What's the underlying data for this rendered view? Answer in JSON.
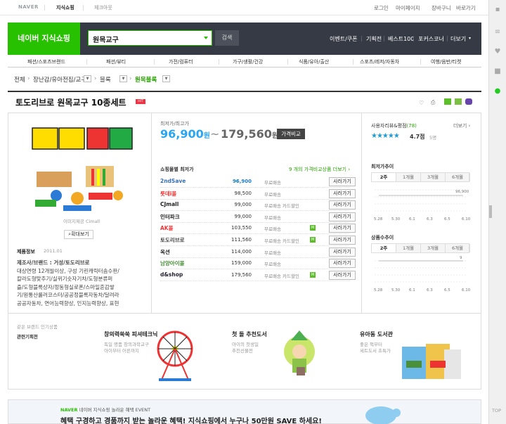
{
  "topbar": {
    "brand": "NAVER",
    "tab1": "지식쇼핑",
    "tab2": "체크아웃",
    "links": [
      "로그인",
      "마이페이지",
      "장바구니",
      "바로가기"
    ]
  },
  "header": {
    "logo": "네이버 지식쇼핑",
    "search_value": "원목교구",
    "search_btn": "검색",
    "links": [
      "이벤트/쿠폰",
      "기획전",
      "베스트100",
      "포커스코너",
      "더보기"
    ]
  },
  "categories": [
    "패션/스포츠브랜드",
    "패션/뷰티",
    "가전/컴퓨터",
    "가구/생활/건강",
    "식품/유아/출산",
    "스포츠/레저/자동차",
    "여행/음반/티켓"
  ],
  "breadcrumb": {
    "all": "전체",
    "c1": "장난감/유아전집/교구",
    "c2": "블록",
    "c3": "원목블록"
  },
  "product": {
    "title": "토도리브로 원목교구 10종세트",
    "hit": "HIT",
    "image_caption": "이미지제공 Cimall",
    "zoom_btn": "확대보기",
    "info_title": "제품정보",
    "info_date": "2011.01",
    "info_lines": [
      "제조사/브랜드 : 거성/토도리브로",
      "대상연령 12개월이상, 구성 기린캐릭터솜수판/",
      "칼라도형맞추기/실뀌기숫자기차/도형분류퍼",
      "즐/도형블록상자/정동형실로폰/스마일흔감쌓",
      "기/원통산룰러코스터/공공정블록자동차/달려라",
      "공공자동차, 연어능력향상, 인지능력향상, 표현"
    ],
    "price_label": "최저가/최고가",
    "price_min": "96,900",
    "price_max": "179,560",
    "won": "원",
    "tilde": "~",
    "compare_btn": "가격비교",
    "mall_header": "쇼핑몰별 최저가",
    "mall_more": "9 개의 가격비교상품 더보기 ›",
    "malls": [
      {
        "name": "2ndSave",
        "price": "96,900",
        "ship": "무료배송",
        "badge": "",
        "buy": "사러가기"
      },
      {
        "name": "롯데i몰",
        "price": "98,500",
        "ship": "무료배송",
        "badge": "",
        "buy": "사러가기"
      },
      {
        "name": "CJmall",
        "price": "99,000",
        "ship": "무료배송 카드할인",
        "badge": "",
        "buy": "사러가기"
      },
      {
        "name": "인터파크",
        "price": "99,000",
        "ship": "무료배송",
        "badge": "",
        "buy": "사러가기"
      },
      {
        "name": "AK몰",
        "price": "103,550",
        "ship": "무료배송",
        "badge": "M",
        "buy": "사러가기"
      },
      {
        "name": "토도리브로",
        "price": "111,560",
        "ship": "무료배송 카드할인",
        "badge": "M",
        "buy": "사러가기"
      },
      {
        "name": "옥션",
        "price": "114,000",
        "ship": "무료배송",
        "badge": "",
        "buy": "사러가기"
      },
      {
        "name": "남양아이몰",
        "price": "159,000",
        "ship": "무료배송",
        "badge": "",
        "buy": "사러가기"
      },
      {
        "name": "d&shop",
        "price": "179,560",
        "ship": "무료배송 카드할인",
        "badge": "M",
        "buy": "사러가기"
      }
    ],
    "rating_label": "사용자리뷰&평점",
    "rating_count_label": "(78)",
    "rating": "4.7점",
    "review_count": "5명",
    "more": "더보기 ›",
    "stars": "★★★★★"
  },
  "chart_data": [
    {
      "type": "line",
      "title": "최저가추이",
      "tabs": [
        "2주",
        "1개월",
        "3개월",
        "6개월"
      ],
      "x": [
        "5.28",
        "5.30",
        "6.1",
        "6.3",
        "6.5",
        "6.10"
      ],
      "label": "96,900",
      "values": [
        96900,
        96900,
        96900,
        96900,
        96900,
        96900
      ]
    },
    {
      "type": "line",
      "title": "상품수추이",
      "tabs": [
        "2주",
        "1개월",
        "3개월",
        "6개월"
      ],
      "x": [
        "5.28",
        "5.30",
        "6.1",
        "6.3",
        "6.5",
        "6.10"
      ],
      "label": "9",
      "values": [
        9,
        9,
        9,
        9,
        9,
        9
      ]
    }
  ],
  "recommend": {
    "left1": "같은 브랜드 인기상품",
    "left2": "관련기획전",
    "items": [
      {
        "title": "창의력쑥쑥 피셔테크닉",
        "sub": [
          "독일 명품 창의과학교구",
          "아이부터 어른까지"
        ]
      },
      {
        "title": "첫 돌 추천도서",
        "sub": [
          "아이의 첫생일",
          "추천선물전"
        ]
      },
      {
        "title": "유아동 도서관",
        "sub": [
          "좋은 책부터",
          "세트도서 초특가"
        ]
      }
    ]
  },
  "banner": {
    "line1_brand": "NAVER",
    "line1": "네이버 지식쇼핑 놀라운 혜택 EVENT",
    "line2": "혜택 구경하고 경품까지 받는 놀라운 혜택! 지식쇼핑에서 누구나 50만원 SAVE 하세요!"
  },
  "rail": {
    "top": "TOP"
  }
}
